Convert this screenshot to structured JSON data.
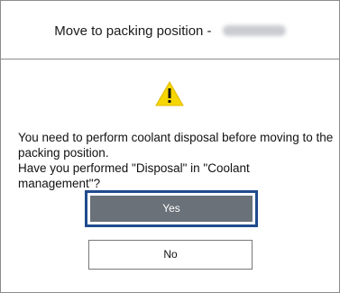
{
  "dialog": {
    "title": "Move to packing position -",
    "title_suffix_redacted": true,
    "icon": "warning-triangle-icon",
    "message_lines": [
      "You need to perform coolant disposal before moving to the packing position.",
      "Have you performed \"Disposal\" in \"Coolant management\"?"
    ],
    "buttons": {
      "yes_label": "Yes",
      "no_label": "No"
    }
  },
  "colors": {
    "warning_yellow": "#f6d600",
    "focus_border": "#1f4b8c",
    "primary_button": "#6b7179"
  }
}
